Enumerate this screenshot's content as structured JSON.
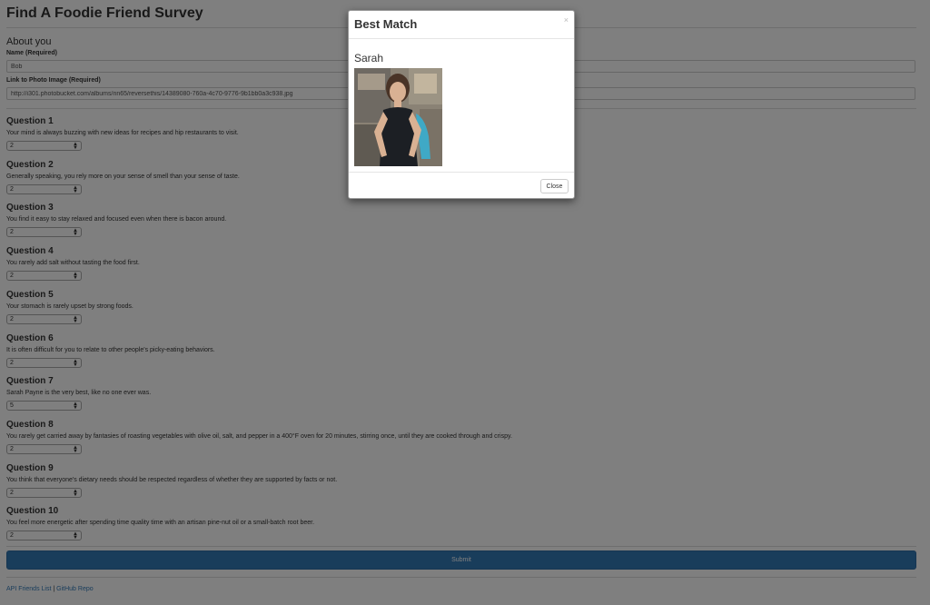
{
  "page": {
    "title": "Find A Foodie Friend Survey"
  },
  "about": {
    "heading": "About you",
    "name_label": "Name (Required)",
    "name_value": "Bob",
    "photo_label": "Link to Photo Image (Required)",
    "photo_value": "http://i301.photobucket.com/albums/nn65/reversethis/14389080-760a-4c70-9776-9b1bb0a3c938.jpg"
  },
  "questions": [
    {
      "title": "Question 1",
      "text": "Your mind is always buzzing with new ideas for recipes and hip restaurants to visit.",
      "value": "2"
    },
    {
      "title": "Question 2",
      "text": "Generally speaking, you rely more on your sense of smell than your sense of taste.",
      "value": "2"
    },
    {
      "title": "Question 3",
      "text": "You find it easy to stay relaxed and focused even when there is bacon around.",
      "value": "2"
    },
    {
      "title": "Question 4",
      "text": "You rarely add salt without tasting the food first.",
      "value": "2"
    },
    {
      "title": "Question 5",
      "text": "Your stomach is rarely upset by strong foods.",
      "value": "2"
    },
    {
      "title": "Question 6",
      "text": "It is often difficult for you to relate to other people's picky-eating behaviors.",
      "value": "2"
    },
    {
      "title": "Question 7",
      "text": "Sarah Payne is the very best, like no one ever was.",
      "value": "5"
    },
    {
      "title": "Question 8",
      "text": "You rarely get carried away by fantasies of roasting vegetables with olive oil, salt, and pepper in a 400°F oven for 20 minutes, stirring once, until they are cooked through and crispy.",
      "value": "2"
    },
    {
      "title": "Question 9",
      "text": "You think that everyone's dietary needs should be respected regardless of whether they are supported by facts or not.",
      "value": "2"
    },
    {
      "title": "Question 10",
      "text": "You feel more energetic after spending time quality time with an artisan pine-nut oil or a small-batch root beer.",
      "value": "2"
    }
  ],
  "submit_label": "Submit",
  "footer": {
    "api_link": "API Friends List",
    "separator": "|",
    "github_link": "GitHub Repo"
  },
  "modal": {
    "title": "Best Match",
    "close_x": "×",
    "match_name": "Sarah",
    "close_label": "Close"
  },
  "colors": {
    "primary": "#337ab7",
    "overlay": "rgba(0,0,0,0.5)"
  }
}
